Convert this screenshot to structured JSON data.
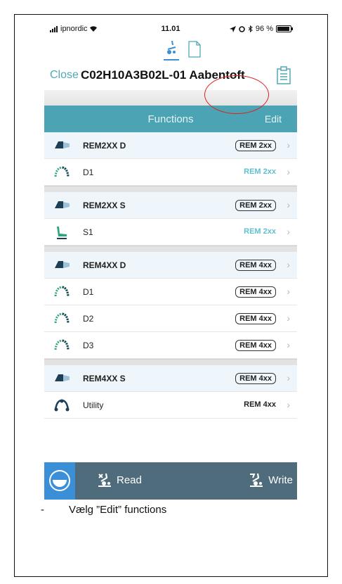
{
  "status_bar": {
    "carrier": "ipnordic",
    "time": "11.01",
    "battery": "96 %"
  },
  "nav": {
    "close_label": "Close",
    "title": "C02H10A3B02L-01 Aabentoft"
  },
  "functions_bar": {
    "title": "Functions",
    "edit_label": "Edit"
  },
  "list": {
    "rows": [
      {
        "type": "group",
        "icon": "joystick-module-icon",
        "name": "REM2XX D",
        "tag": "REM 2xx",
        "tag_style": "boxed"
      },
      {
        "type": "item",
        "icon": "drive-profile-icon",
        "name": "D1",
        "tag": "REM 2xx",
        "tag_style": "teal"
      },
      {
        "type": "separator"
      },
      {
        "type": "group",
        "icon": "joystick-module-icon",
        "name": "REM2XX S",
        "tag": "REM 2xx",
        "tag_style": "boxed"
      },
      {
        "type": "item",
        "icon": "seat-icon",
        "name": "S1",
        "tag": "REM 2xx",
        "tag_style": "teal"
      },
      {
        "type": "separator"
      },
      {
        "type": "group",
        "icon": "joystick-module-icon",
        "name": "REM4XX D",
        "tag": "REM 4xx",
        "tag_style": "boxed"
      },
      {
        "type": "item",
        "icon": "drive-profile-icon",
        "name": "D1",
        "tag": "REM 4xx",
        "tag_style": "boxed"
      },
      {
        "type": "item",
        "icon": "drive-profile-icon",
        "name": "D2",
        "tag": "REM 4xx",
        "tag_style": "boxed"
      },
      {
        "type": "item",
        "icon": "drive-profile-icon",
        "name": "D3",
        "tag": "REM 4xx",
        "tag_style": "boxed"
      },
      {
        "type": "separator"
      },
      {
        "type": "group",
        "icon": "joystick-module-icon",
        "name": "REM4XX S",
        "tag": "REM 4xx",
        "tag_style": "boxed"
      },
      {
        "type": "item",
        "icon": "utility-icon",
        "name": "Utility",
        "tag": "REM 4xx",
        "tag_style": "dark"
      }
    ]
  },
  "bottom_bar": {
    "read_label": "Read",
    "write_label": "Write"
  },
  "caption": {
    "bullet": "-",
    "text": "Vælg ”Edit” functions"
  },
  "colors": {
    "teal": "#4ba3b3",
    "link": "#4ea8b8",
    "bottom_bar": "#4e6c7c",
    "home_button": "#3a8fd6",
    "highlight": "#e02020"
  }
}
